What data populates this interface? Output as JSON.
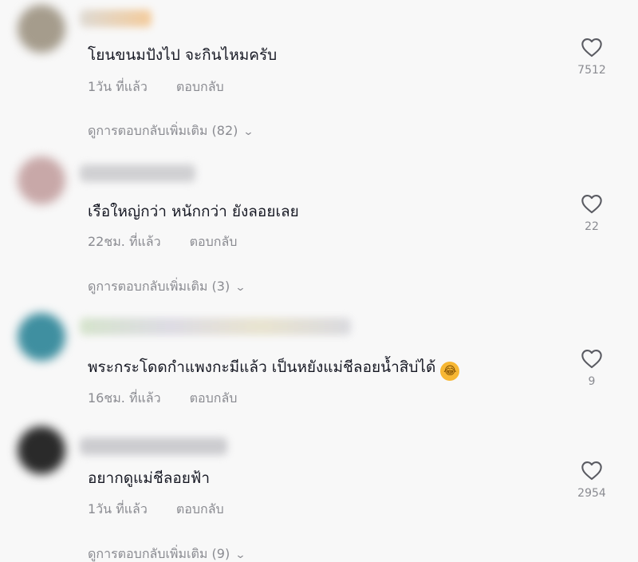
{
  "comments": [
    {
      "text": "โยนขนมปังไป จะกินไหมครับ",
      "time": "1วัน ที่แล้ว",
      "reply_label": "ตอบกลับ",
      "likes": "7512",
      "more_replies": "ดูการตอบกลับเพิ่มเติม (82)"
    },
    {
      "text": "เรือใหญ่กว่า หนักกว่า ยังลอยเลย",
      "time": "22ชม. ที่แล้ว",
      "reply_label": "ตอบกลับ",
      "likes": "22",
      "more_replies": "ดูการตอบกลับเพิ่มเติม (3)"
    },
    {
      "text": "พระกระโดดกำแพงกะมีแล้ว เป็นหยังแม่ชีลอยน้ำสิบ่ได้",
      "emoji": "😂",
      "time": "16ชม. ที่แล้ว",
      "reply_label": "ตอบกลับ",
      "likes": "9"
    },
    {
      "text": "อยากดูแม่ชีลอยฟ้า",
      "time": "1วัน ที่แล้ว",
      "reply_label": "ตอบกลับ",
      "likes": "2954",
      "more_replies": "ดูการตอบกลับเพิ่มเติม (9)"
    }
  ],
  "icons": {
    "like": "heart-icon",
    "expand": "chevron-down-icon"
  },
  "colors": {
    "text": "#161823",
    "muted": "#8a8b91",
    "background": "#f8f8f8"
  }
}
